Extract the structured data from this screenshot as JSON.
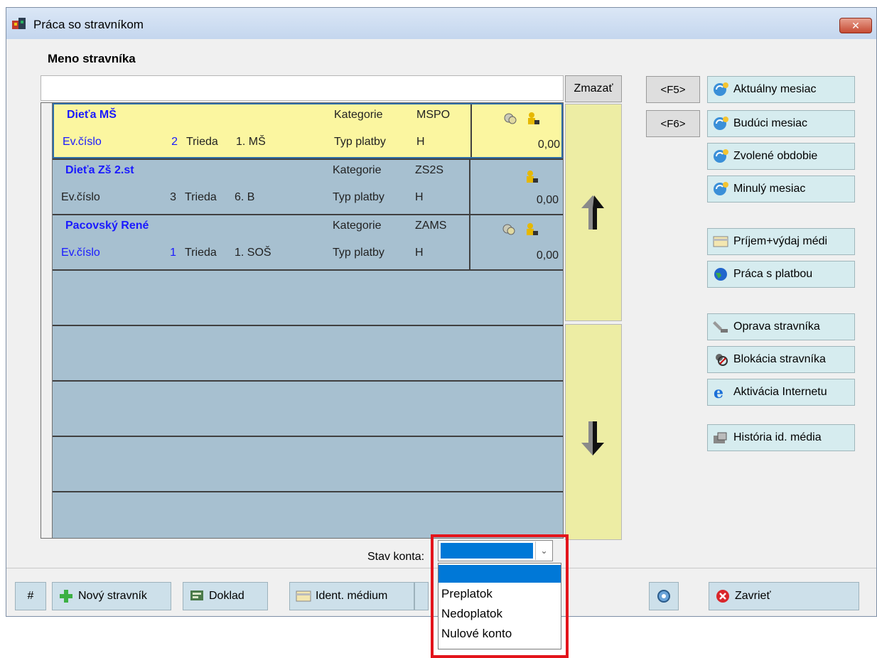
{
  "window": {
    "title": "Práca so stravníkom",
    "close_glyph": "✕"
  },
  "search": {
    "label": "Meno stravníka",
    "value": "",
    "clear_label": "Zmazať"
  },
  "rows": [
    {
      "name": "Dieťa MŠ",
      "ev_label": "Ev.číslo",
      "ev_num": "2",
      "trieda_label": "Trieda",
      "trieda": "1. MŠ",
      "kategorie_label": "Kategorie",
      "kategorie": "MSPO",
      "typ_label": "Typ platby",
      "typ": "H",
      "amount": "0,00",
      "icons": [
        "coins-icon",
        "user-lock-icon"
      ]
    },
    {
      "name": "Dieťa Zš 2.st",
      "ev_label": "Ev.číslo",
      "ev_num": "3",
      "trieda_label": "Trieda",
      "trieda": "6. B",
      "kategorie_label": "Kategorie",
      "kategorie": "ZS2S",
      "typ_label": "Typ platby",
      "typ": "H",
      "amount": "0,00",
      "icons": [
        "user-lock-icon"
      ]
    },
    {
      "name": "Pacovský René",
      "ev_label": "Ev.číslo",
      "ev_num": "1",
      "trieda_label": "Trieda",
      "trieda": "1. SOŠ",
      "kategorie_label": "Kategorie",
      "kategorie": "ZAMS",
      "typ_label": "Typ platby",
      "typ": "H",
      "amount": "0,00",
      "icons": [
        "coins-icon",
        "user-lock-icon"
      ]
    }
  ],
  "side": {
    "f5": "<F5>",
    "f6": "<F6>",
    "aktualny": "Aktuálny mesiac",
    "buduci": "Budúci mesiac",
    "zvolene": "Zvolené obdobie",
    "minuly": "Minulý mesiac",
    "prijem": "Príjem+výdaj médi",
    "praca_platbou": "Práca s platbou",
    "oprava": "Oprava stravníka",
    "blokacia": "Blokácia stravníka",
    "aktivacia": "Aktivácia Internetu",
    "historia": "História id. média"
  },
  "stav": {
    "label": "Stav konta:",
    "options": [
      "",
      "Preplatok",
      "Nedoplatok",
      "Nulové konto"
    ]
  },
  "bottom": {
    "hash": "#",
    "novy": "Nový stravník",
    "doklad": "Doklad",
    "ident": "Ident. médium",
    "zavriet": "Zavrieť"
  },
  "colors": {
    "selected_row": "#fbf6a0",
    "grid_bg": "#a7c0d0",
    "name_blue": "#1a1aff",
    "highlight": "#e3141b",
    "selection_blue": "#0078d7"
  }
}
